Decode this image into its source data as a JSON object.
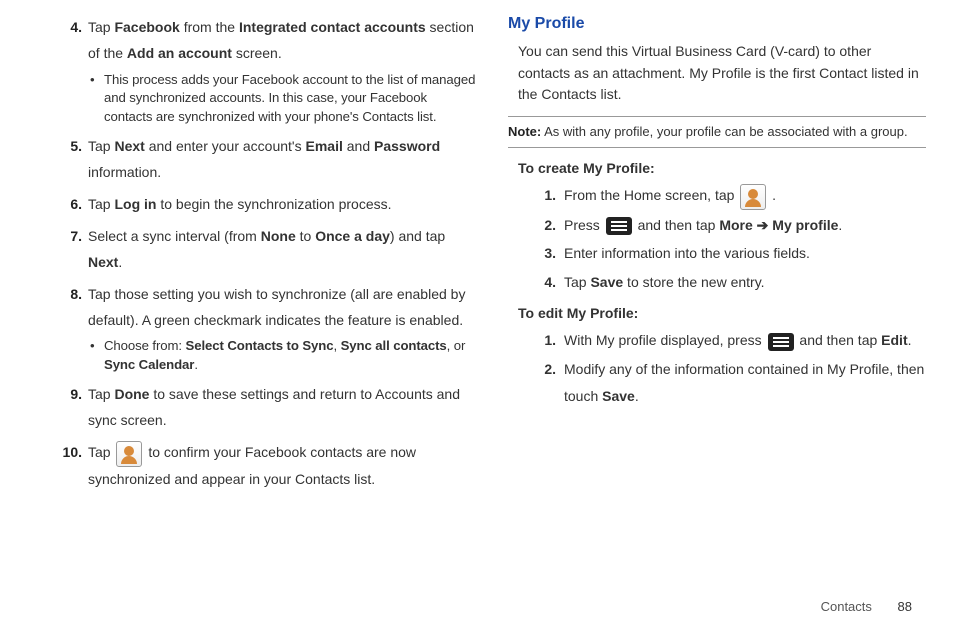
{
  "left": {
    "step4_a": "Tap ",
    "step4_b1": "Facebook",
    "step4_c": " from the ",
    "step4_b2": "Integrated contact accounts",
    "step4_d": " section of the ",
    "step4_b3": "Add an account",
    "step4_e": " screen.",
    "step4_bullet": "This process adds your Facebook account to the list of managed and synchronized accounts. In this case, your Facebook contacts are synchronized with your phone's Contacts list.",
    "step5_a": "Tap ",
    "step5_b1": "Next",
    "step5_c": " and enter your account's ",
    "step5_b2": "Email",
    "step5_d": " and ",
    "step5_b3": "Password",
    "step5_e": " information.",
    "step6_a": "Tap ",
    "step6_b1": "Log in",
    "step6_c": " to begin the synchronization process.",
    "step7_a": "Select a sync interval (from ",
    "step7_b1": "None",
    "step7_c": " to ",
    "step7_b2": "Once a day",
    "step7_d": ") and tap ",
    "step7_b3": "Next",
    "step7_e": ".",
    "step8": "Tap those setting you wish to synchronize (all are enabled by default). A green checkmark indicates the feature is enabled.",
    "step8_bullet_a": "Choose from: ",
    "step8_bullet_b1": "Select Contacts to Sync",
    "step8_bullet_c": ", ",
    "step8_bullet_b2": "Sync all contacts",
    "step8_bullet_d": ", or ",
    "step8_bullet_b3": "Sync Calendar",
    "step8_bullet_e": ".",
    "step9_a": "Tap ",
    "step9_b1": "Done",
    "step9_c": " to save these settings and return to Accounts and sync screen.",
    "step10_a": "Tap  ",
    "step10_b": "  to confirm your Facebook contacts are now synchronized and appear in your Contacts list."
  },
  "right": {
    "heading": "My Profile",
    "intro": "You can send this Virtual Business Card (V-card) to other contacts as an attachment. My Profile is the first Contact listed in the Contacts list.",
    "note_label": "Note:",
    "note_text": " As with any profile, your profile can be associated with a group.",
    "create_head": "To create My Profile:",
    "c1_a": "From the Home screen, tap  ",
    "c1_b": " .",
    "c2_a": "Press ",
    "c2_b": " and then tap ",
    "c2_b1": "More",
    "c2_arrow": " ➔ ",
    "c2_b2": "My profile",
    "c2_c": ".",
    "c3": "Enter information into the various fields.",
    "c4_a": "Tap ",
    "c4_b1": "Save",
    "c4_c": " to store the new entry.",
    "edit_head": "To edit My Profile:",
    "e1_a": "With My profile displayed, press ",
    "e1_b": " and then tap ",
    "e1_b1": "Edit",
    "e1_c": ".",
    "e2_a": "Modify any of the information contained in My Profile, then touch ",
    "e2_b1": "Save",
    "e2_c": "."
  },
  "numbers": {
    "n4": "4.",
    "n5": "5.",
    "n6": "6.",
    "n7": "7.",
    "n8": "8.",
    "n9": "9.",
    "n10": "10.",
    "s1": "1.",
    "s2": "2.",
    "s3": "3.",
    "s4": "4."
  },
  "footer": {
    "section": "Contacts",
    "page": "88"
  }
}
